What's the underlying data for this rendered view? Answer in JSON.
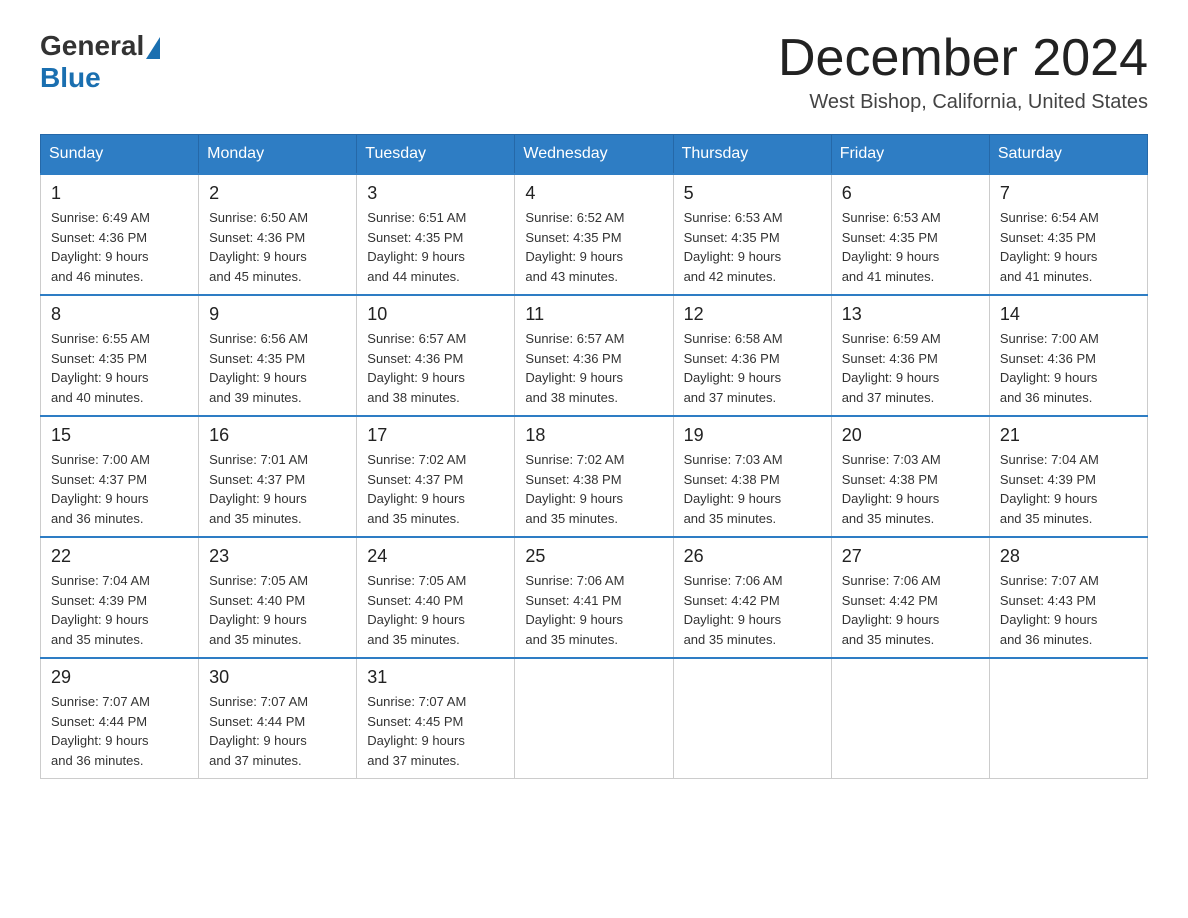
{
  "header": {
    "logo_general": "General",
    "logo_blue": "Blue",
    "month": "December 2024",
    "location": "West Bishop, California, United States"
  },
  "weekdays": [
    "Sunday",
    "Monday",
    "Tuesday",
    "Wednesday",
    "Thursday",
    "Friday",
    "Saturday"
  ],
  "weeks": [
    [
      {
        "day": "1",
        "sunrise": "6:49 AM",
        "sunset": "4:36 PM",
        "daylight": "9 hours and 46 minutes."
      },
      {
        "day": "2",
        "sunrise": "6:50 AM",
        "sunset": "4:36 PM",
        "daylight": "9 hours and 45 minutes."
      },
      {
        "day": "3",
        "sunrise": "6:51 AM",
        "sunset": "4:35 PM",
        "daylight": "9 hours and 44 minutes."
      },
      {
        "day": "4",
        "sunrise": "6:52 AM",
        "sunset": "4:35 PM",
        "daylight": "9 hours and 43 minutes."
      },
      {
        "day": "5",
        "sunrise": "6:53 AM",
        "sunset": "4:35 PM",
        "daylight": "9 hours and 42 minutes."
      },
      {
        "day": "6",
        "sunrise": "6:53 AM",
        "sunset": "4:35 PM",
        "daylight": "9 hours and 41 minutes."
      },
      {
        "day": "7",
        "sunrise": "6:54 AM",
        "sunset": "4:35 PM",
        "daylight": "9 hours and 41 minutes."
      }
    ],
    [
      {
        "day": "8",
        "sunrise": "6:55 AM",
        "sunset": "4:35 PM",
        "daylight": "9 hours and 40 minutes."
      },
      {
        "day": "9",
        "sunrise": "6:56 AM",
        "sunset": "4:35 PM",
        "daylight": "9 hours and 39 minutes."
      },
      {
        "day": "10",
        "sunrise": "6:57 AM",
        "sunset": "4:36 PM",
        "daylight": "9 hours and 38 minutes."
      },
      {
        "day": "11",
        "sunrise": "6:57 AM",
        "sunset": "4:36 PM",
        "daylight": "9 hours and 38 minutes."
      },
      {
        "day": "12",
        "sunrise": "6:58 AM",
        "sunset": "4:36 PM",
        "daylight": "9 hours and 37 minutes."
      },
      {
        "day": "13",
        "sunrise": "6:59 AM",
        "sunset": "4:36 PM",
        "daylight": "9 hours and 37 minutes."
      },
      {
        "day": "14",
        "sunrise": "7:00 AM",
        "sunset": "4:36 PM",
        "daylight": "9 hours and 36 minutes."
      }
    ],
    [
      {
        "day": "15",
        "sunrise": "7:00 AM",
        "sunset": "4:37 PM",
        "daylight": "9 hours and 36 minutes."
      },
      {
        "day": "16",
        "sunrise": "7:01 AM",
        "sunset": "4:37 PM",
        "daylight": "9 hours and 35 minutes."
      },
      {
        "day": "17",
        "sunrise": "7:02 AM",
        "sunset": "4:37 PM",
        "daylight": "9 hours and 35 minutes."
      },
      {
        "day": "18",
        "sunrise": "7:02 AM",
        "sunset": "4:38 PM",
        "daylight": "9 hours and 35 minutes."
      },
      {
        "day": "19",
        "sunrise": "7:03 AM",
        "sunset": "4:38 PM",
        "daylight": "9 hours and 35 minutes."
      },
      {
        "day": "20",
        "sunrise": "7:03 AM",
        "sunset": "4:38 PM",
        "daylight": "9 hours and 35 minutes."
      },
      {
        "day": "21",
        "sunrise": "7:04 AM",
        "sunset": "4:39 PM",
        "daylight": "9 hours and 35 minutes."
      }
    ],
    [
      {
        "day": "22",
        "sunrise": "7:04 AM",
        "sunset": "4:39 PM",
        "daylight": "9 hours and 35 minutes."
      },
      {
        "day": "23",
        "sunrise": "7:05 AM",
        "sunset": "4:40 PM",
        "daylight": "9 hours and 35 minutes."
      },
      {
        "day": "24",
        "sunrise": "7:05 AM",
        "sunset": "4:40 PM",
        "daylight": "9 hours and 35 minutes."
      },
      {
        "day": "25",
        "sunrise": "7:06 AM",
        "sunset": "4:41 PM",
        "daylight": "9 hours and 35 minutes."
      },
      {
        "day": "26",
        "sunrise": "7:06 AM",
        "sunset": "4:42 PM",
        "daylight": "9 hours and 35 minutes."
      },
      {
        "day": "27",
        "sunrise": "7:06 AM",
        "sunset": "4:42 PM",
        "daylight": "9 hours and 35 minutes."
      },
      {
        "day": "28",
        "sunrise": "7:07 AM",
        "sunset": "4:43 PM",
        "daylight": "9 hours and 36 minutes."
      }
    ],
    [
      {
        "day": "29",
        "sunrise": "7:07 AM",
        "sunset": "4:44 PM",
        "daylight": "9 hours and 36 minutes."
      },
      {
        "day": "30",
        "sunrise": "7:07 AM",
        "sunset": "4:44 PM",
        "daylight": "9 hours and 37 minutes."
      },
      {
        "day": "31",
        "sunrise": "7:07 AM",
        "sunset": "4:45 PM",
        "daylight": "9 hours and 37 minutes."
      },
      null,
      null,
      null,
      null
    ]
  ]
}
